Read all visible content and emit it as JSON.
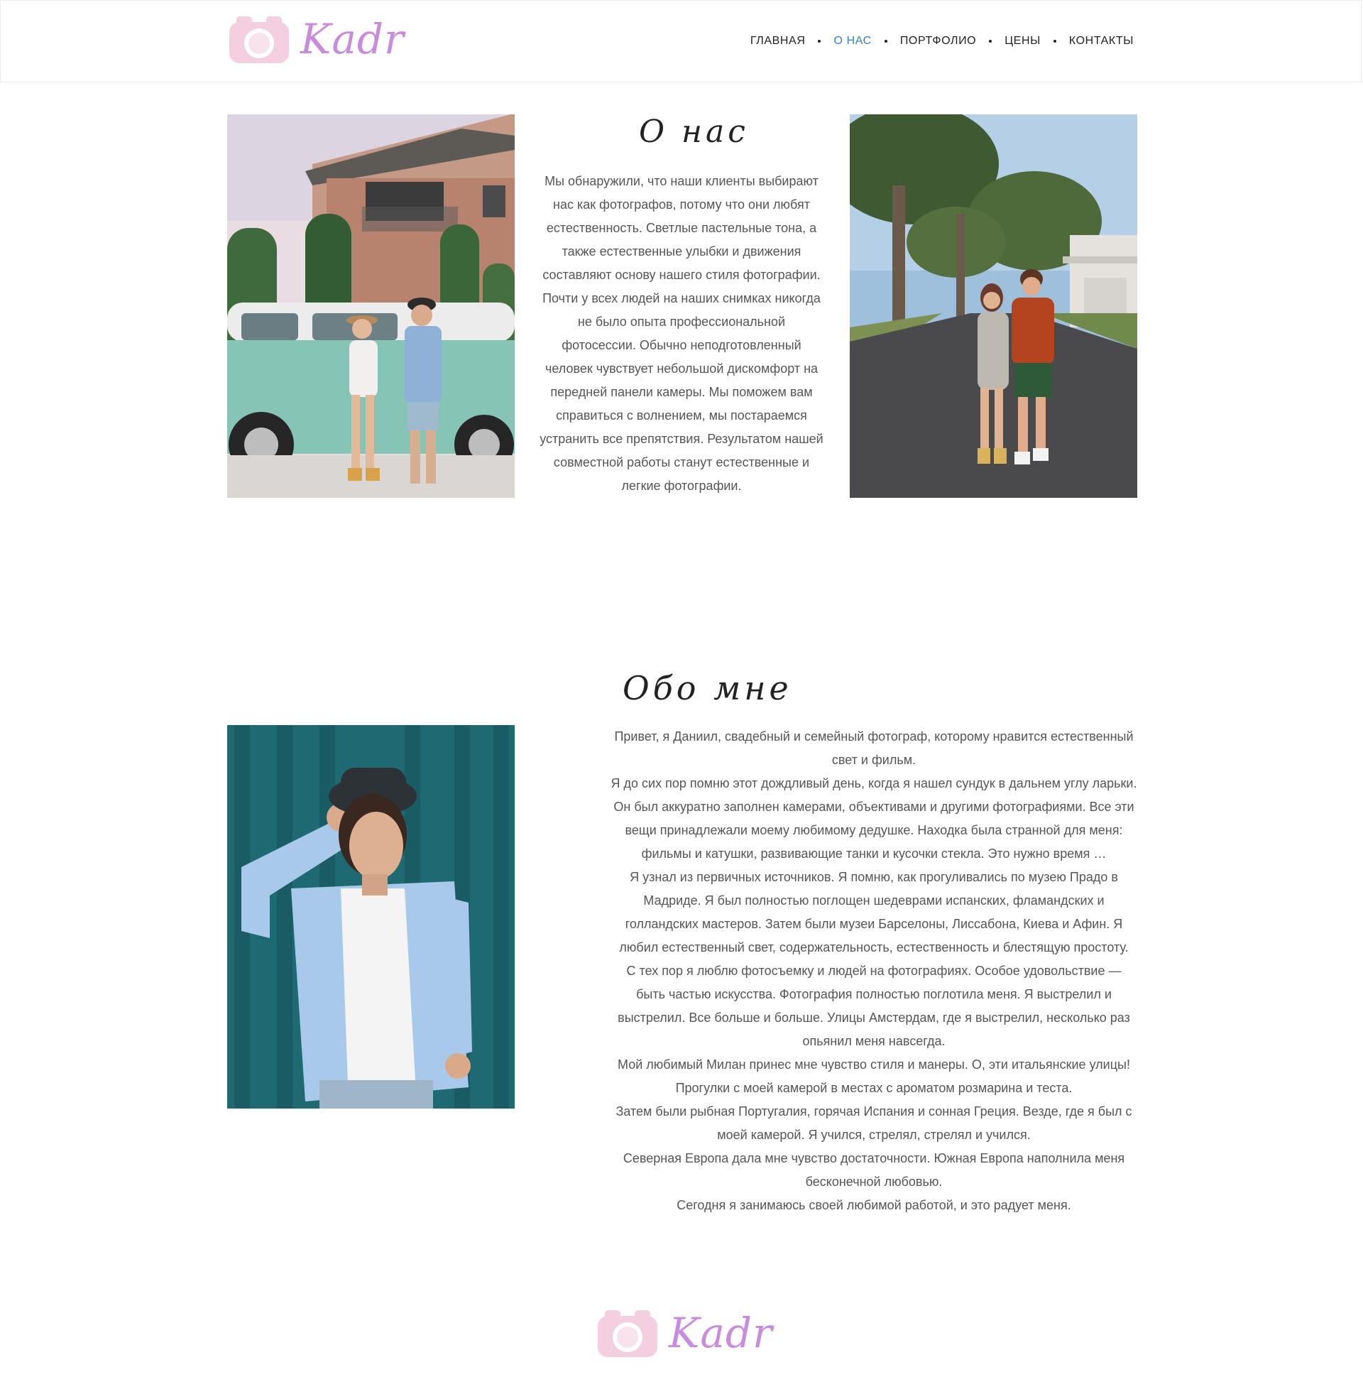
{
  "header": {
    "logo_text": "Kadr",
    "nav": [
      {
        "label": "ГЛАВНАЯ",
        "active": false
      },
      {
        "label": "О НАС",
        "active": true
      },
      {
        "label": "ПОРТФОЛИО",
        "active": false
      },
      {
        "label": "ЦЕНЫ",
        "active": false
      },
      {
        "label": "КОНТАКТЫ",
        "active": false
      }
    ]
  },
  "about_us": {
    "title": "О нас",
    "text": "Мы обнаружили, что наши клиенты выбирают нас как фотографов, потому что они любят естественность. Светлые пастельные тона, а также естественные улыбки и движения составляют основу нашего стиля фотографии. Почти у всех людей на наших снимках никогда не было опыта профессиональной фотосессии. Обычно неподготовленный человек чувствует небольшой дискомфорт на передней панели камеры. Мы поможем вам справиться с волнением, мы постараемся устранить все препятствия. Результатом нашей совместной работы станут естественные и легкие фотографии."
  },
  "about_me": {
    "title": "Обо мне",
    "paragraphs": [
      "Привет, я Даниил, свадебный и семейный фотограф, которому нравится естественный свет и фильм.",
      "Я до сих пор помню этот дождливый день, когда я нашел сундук в дальнем углу ларьки. Он был аккуратно заполнен камерами, объективами и другими фотографиями. Все эти вещи принадлежали моему любимому дедушке. Находка была странной для меня: фильмы и катушки, развивающие танки и кусочки стекла. Это нужно время …",
      "Я узнал из первичных источников. Я помню, как прогуливались по музею Прадо в Мадриде. Я был полностью поглощен шедеврами испанских, фламандских и голландских мастеров. Затем были музеи Барселоны, Лиссабона, Киева и Афин. Я любил естественный свет, содержательность, естественность и блестящую простоту.",
      "С тех пор я люблю фотосъемку и людей на фотографиях. Особое удовольствие — быть частью искусства. Фотография полностью поглотила меня. Я выстрелил и выстрелил. Все больше и больше. Улицы Амстердам, где я выстрелил, несколько раз опьянил меня навсегда.",
      "Мой любимый Милан принес мне чувство стиля и манеры. О, эти итальянские улицы! Прогулки с моей камерой в местах с ароматом розмарина и теста.",
      "Затем были рыбная Португалия, горячая Испания и сонная Греция. Везде, где я был с моей камерой. Я учился, стрелял, стрелял и учился.",
      "Северная Европа дала мне чувство достаточности. Южная Европа наполнила меня бесконечной любовью.",
      "Сегодня я занимаюсь своей любимой работой, и это радует меня."
    ]
  },
  "footer": {
    "logo_text": "Kadr"
  },
  "colors": {
    "logo_pink": "#f3cfe0",
    "logo_purple": "#c98bdb",
    "nav_active": "#3a7ec6",
    "text": "#555555"
  }
}
